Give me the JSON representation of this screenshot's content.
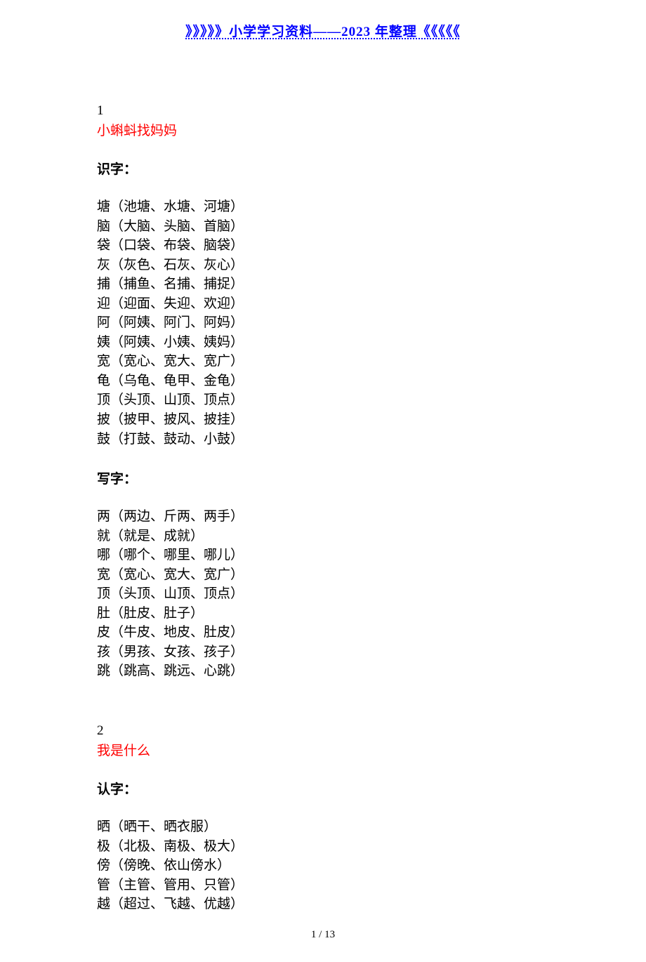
{
  "header": "》》》》》小学学习资料——2023 年整理《《《《《",
  "lessons": [
    {
      "num": "1",
      "title": "小蝌蚪找妈妈",
      "sections": [
        {
          "label": "识字：",
          "entries": [
            "塘（池塘、水塘、河塘）",
            "脑（大脑、头脑、首脑）",
            "袋（口袋、布袋、脑袋）",
            "灰（灰色、石灰、灰心）",
            "捕（捕鱼、名捕、捕捉）",
            "迎（迎面、失迎、欢迎）",
            "阿（阿姨、阿门、阿妈）",
            "姨（阿姨、小姨、姨妈）",
            "宽（宽心、宽大、宽广）",
            "龟（乌龟、龟甲、金龟）",
            "顶（头顶、山顶、顶点）",
            "披（披甲、披风、披挂）",
            "鼓（打鼓、鼓动、小鼓）"
          ]
        },
        {
          "label": "写字：",
          "entries": [
            "两（两边、斤两、两手）",
            "就（就是、成就）",
            "哪（哪个、哪里、哪儿）",
            "宽（宽心、宽大、宽广）",
            "顶（头顶、山顶、顶点）",
            "肚（肚皮、肚子）",
            "皮（牛皮、地皮、肚皮）",
            "孩（男孩、女孩、孩子）",
            "跳（跳高、跳远、心跳）"
          ]
        }
      ]
    },
    {
      "num": "2",
      "title": "我是什么",
      "sections": [
        {
          "label": "认字：",
          "entries": [
            "晒（晒干、晒衣服）",
            "极（北极、南极、极大）",
            "傍（傍晚、依山傍水）",
            "管（主管、管用、只管）",
            "越（超过、飞越、优越）"
          ]
        }
      ]
    }
  ],
  "pageNum": "1 / 13"
}
